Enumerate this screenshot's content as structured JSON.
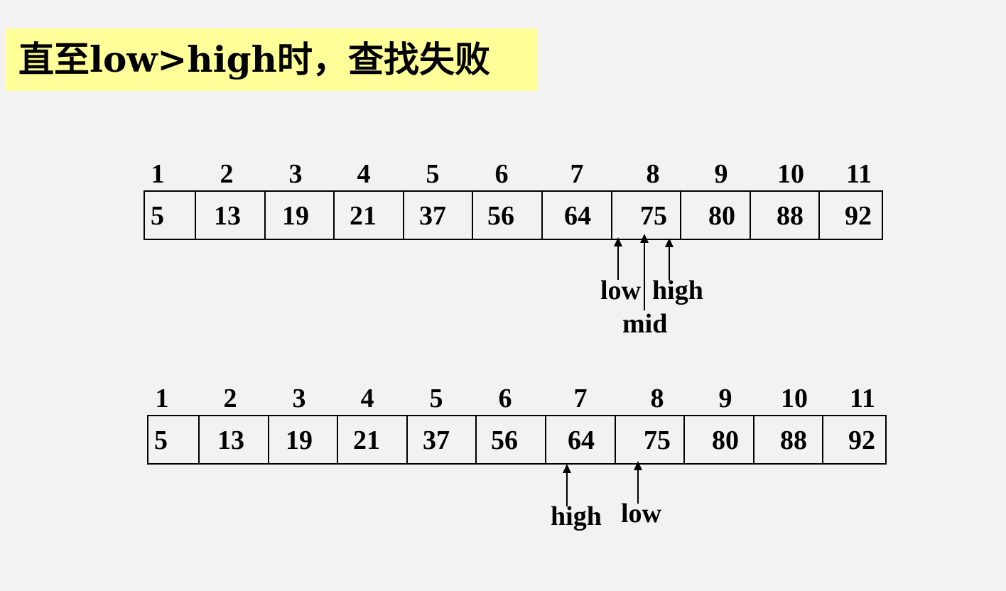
{
  "title": "直至low>high时，查找失败",
  "indices": [
    "1",
    "2",
    "3",
    "4",
    "5",
    "6",
    "7",
    "8",
    "9",
    "10",
    "11"
  ],
  "values": [
    "5",
    "13",
    "19",
    "21",
    "37",
    "56",
    "64",
    "75",
    "80",
    "88",
    "92"
  ],
  "diagram1": {
    "low_label": "low",
    "mid_label": "mid",
    "high_label": "high"
  },
  "diagram2": {
    "high_label": "high",
    "low_label": "low"
  }
}
